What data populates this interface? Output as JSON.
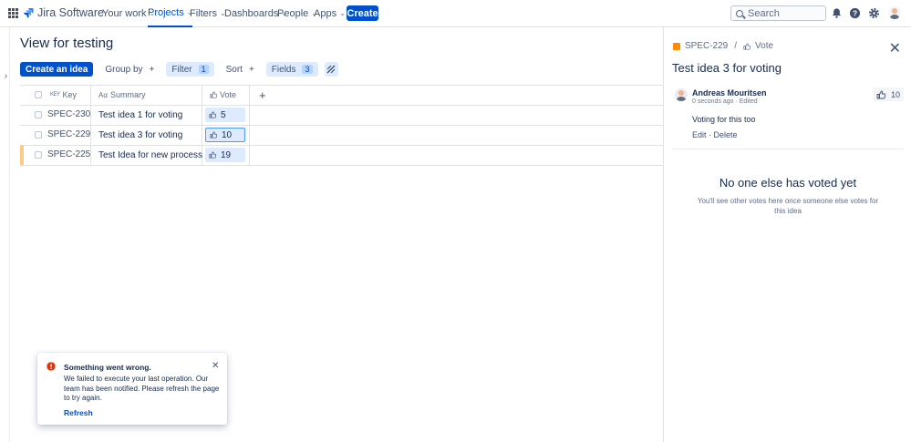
{
  "topnav": {
    "product": "Jira Software",
    "items": [
      {
        "label": "Your work"
      },
      {
        "label": "Projects"
      },
      {
        "label": "Filters"
      },
      {
        "label": "Dashboards"
      },
      {
        "label": "People"
      },
      {
        "label": "Apps"
      }
    ],
    "active": "Projects",
    "create_label": "Create",
    "search_placeholder": "Search",
    "icons": [
      "notifications-icon",
      "help-icon",
      "settings-icon"
    ]
  },
  "main": {
    "title": "View for testing",
    "toolbar": {
      "create_label": "Create an idea",
      "group_label": "Group by",
      "filter_label": "Filter",
      "filter_count": "1",
      "sort_label": "Sort",
      "fields_label": "Fields",
      "fields_count": "3"
    },
    "table": {
      "headers": {
        "key": "Key",
        "summary": "Summary",
        "vote": "Vote"
      },
      "rows": [
        {
          "key": "SPEC-230",
          "summary": "Test idea 1 for voting",
          "votes": "5",
          "selected": false,
          "highlighted": false
        },
        {
          "key": "SPEC-229",
          "summary": "Test idea 3 for voting",
          "votes": "10",
          "selected": true,
          "highlighted": false
        },
        {
          "key": "SPEC-225",
          "summary": "Test Idea for new process",
          "votes": "19",
          "selected": false,
          "highlighted": true
        }
      ]
    }
  },
  "panel": {
    "breadcrumb_key": "SPEC-229",
    "breadcrumb_section": "Vote",
    "title": "Test idea 3 for voting",
    "comment": {
      "author": "Andreas Mouritsen",
      "meta": "0 seconds ago · Edited",
      "body": "Voting for this too",
      "edit_label": "Edit",
      "delete_label": "Delete",
      "votes": "10"
    },
    "empty_title": "No one else has voted yet",
    "empty_text": "You'll see other votes here once someone else votes for this idea"
  },
  "toast": {
    "title": "Something went wrong.",
    "message": "We failed to execute your last operation. Our team has been notified. Please refresh the page to try again.",
    "action": "Refresh"
  },
  "colors": {
    "brand": "#0052cc",
    "vote_bg": "#deebff",
    "error": "#de350b",
    "highlight": "#ffc98a"
  }
}
